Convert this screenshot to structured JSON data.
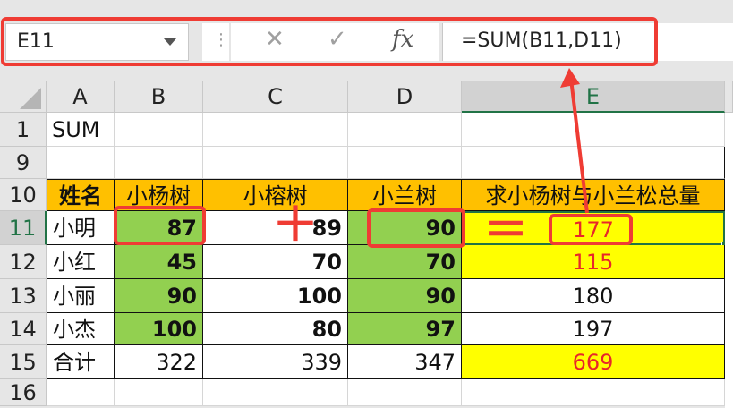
{
  "formula_bar": {
    "name_box": "E11",
    "divider": "⋮",
    "cancel_icon": "✕",
    "enter_icon": "✓",
    "fx_label": "fx",
    "formula": "=SUM(B11,D11)"
  },
  "columns": [
    "A",
    "B",
    "C",
    "D",
    "E"
  ],
  "rows": [
    "1",
    "9",
    "10",
    "11",
    "12",
    "13",
    "14",
    "15",
    "16"
  ],
  "cells": {
    "a1": "SUM",
    "headers": [
      "姓名",
      "小杨树",
      "小榕树",
      "小兰树",
      "求小杨树与小兰松总量"
    ],
    "data": [
      [
        "小明",
        "87",
        "89",
        "90",
        "177"
      ],
      [
        "小红",
        "45",
        "70",
        "70",
        "115"
      ],
      [
        "小丽",
        "90",
        "100",
        "90",
        "180"
      ],
      [
        "小杰",
        "100",
        "80",
        "97",
        "197"
      ],
      [
        "合计",
        "322",
        "339",
        "347",
        "669"
      ]
    ]
  },
  "annotations": {
    "plus": "＋",
    "equals": "＝"
  },
  "colors": {
    "green": "#92d050",
    "orange": "#ffc000",
    "yellow": "#ffff00",
    "highlight_red": "#ef3c34"
  }
}
